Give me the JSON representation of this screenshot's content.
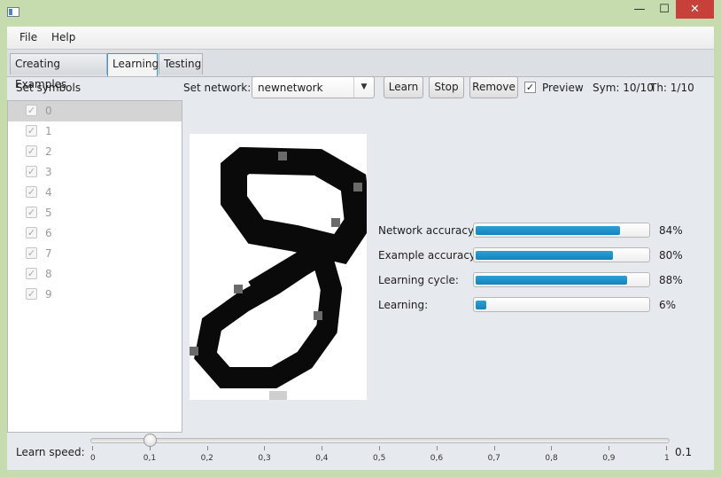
{
  "window": {
    "close_glyph": "✕",
    "minimize_glyph": "—",
    "maximize_glyph": "☐"
  },
  "menu": {
    "file": "File",
    "help": "Help"
  },
  "tabs": [
    {
      "label": "Creating Examples"
    },
    {
      "label": "Learning"
    },
    {
      "label": "Testing"
    }
  ],
  "sidebar": {
    "title": "Set symbols",
    "symbols": [
      {
        "label": "0",
        "checked": true,
        "selected": true
      },
      {
        "label": "1",
        "checked": true
      },
      {
        "label": "2",
        "checked": true
      },
      {
        "label": "3",
        "checked": true
      },
      {
        "label": "4",
        "checked": true
      },
      {
        "label": "5",
        "checked": true
      },
      {
        "label": "6",
        "checked": true
      },
      {
        "label": "7",
        "checked": true
      },
      {
        "label": "8",
        "checked": true
      },
      {
        "label": "9",
        "checked": true
      }
    ]
  },
  "toolbar": {
    "network_label": "Set network:",
    "network_value": "newnetwork",
    "learn": "Learn",
    "stop": "Stop",
    "remove": "Remove",
    "preview": "Preview",
    "preview_checked": true,
    "sym_status": "Sym: 10/10",
    "th_status": "Th: 1/10"
  },
  "metrics": [
    {
      "label": "Network accuracy:",
      "value": 0.84,
      "text": "84%"
    },
    {
      "label": "Example accuracy:",
      "value": 0.8,
      "text": "80%"
    },
    {
      "label": "Learning cycle:",
      "value": 0.88,
      "text": "88%"
    },
    {
      "label": "Learning:",
      "value": 0.06,
      "text": "6%"
    }
  ],
  "learn_speed": {
    "label": "Learn speed:",
    "value": 0.1,
    "display": "0.1",
    "min": 0,
    "max": 1,
    "tick_labels": [
      "0",
      "0,1",
      "0,2",
      "0,3",
      "0,4",
      "0,5",
      "0,6",
      "0,7",
      "0,8",
      "0,9",
      "1"
    ]
  },
  "colors": {
    "progress": "#1a8ec9",
    "close_button": "#c7403a",
    "window_frame": "#c7dcae"
  }
}
